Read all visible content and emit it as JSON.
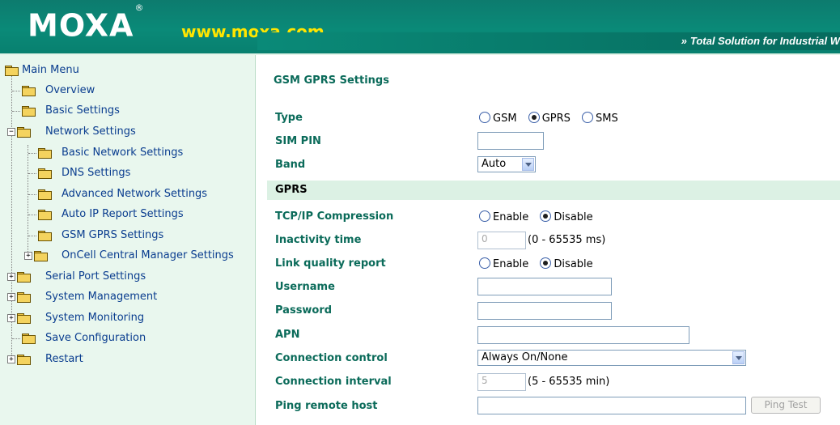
{
  "header": {
    "logo_text": "MOXA",
    "logo_mark": "®",
    "site_url": "www.moxa.com",
    "tagline_arrows": "»",
    "tagline": "Total Solution for Industrial W"
  },
  "sidebar": {
    "items": [
      {
        "label": "Main Menu",
        "expander": ""
      },
      {
        "label": "Overview",
        "expander": ""
      },
      {
        "label": "Basic Settings",
        "expander": ""
      },
      {
        "label": "Network Settings",
        "expander": "−"
      },
      {
        "label": "Basic Network Settings",
        "expander": ""
      },
      {
        "label": "DNS Settings",
        "expander": ""
      },
      {
        "label": "Advanced Network Settings",
        "expander": ""
      },
      {
        "label": "Auto IP Report Settings",
        "expander": ""
      },
      {
        "label": "GSM GPRS Settings",
        "expander": ""
      },
      {
        "label": "OnCell Central Manager Settings",
        "expander": "+"
      },
      {
        "label": "Serial Port Settings",
        "expander": "+"
      },
      {
        "label": "System Management",
        "expander": "+"
      },
      {
        "label": "System Monitoring",
        "expander": "+"
      },
      {
        "label": "Save Configuration",
        "expander": ""
      },
      {
        "label": "Restart",
        "expander": "+"
      }
    ]
  },
  "main": {
    "title": "GSM GPRS Settings",
    "type": {
      "label": "Type",
      "options": [
        "GSM",
        "GPRS",
        "SMS"
      ],
      "selected": "GPRS"
    },
    "sim_pin": {
      "label": "SIM PIN",
      "value": ""
    },
    "band": {
      "label": "Band",
      "value": "Auto"
    },
    "gprs_section": "GPRS",
    "tcp_ip_compression": {
      "label": "TCP/IP Compression",
      "options": [
        "Enable",
        "Disable"
      ],
      "selected": "Disable"
    },
    "inactivity_time": {
      "label": "Inactivity time",
      "value": "0",
      "hint": "(0 - 65535 ms)"
    },
    "link_quality_report": {
      "label": "Link quality report",
      "options": [
        "Enable",
        "Disable"
      ],
      "selected": "Disable"
    },
    "username": {
      "label": "Username",
      "value": ""
    },
    "password": {
      "label": "Password",
      "value": ""
    },
    "apn": {
      "label": "APN",
      "value": ""
    },
    "connection_control": {
      "label": "Connection control",
      "value": "Always On/None"
    },
    "connection_interval": {
      "label": "Connection interval",
      "value": "5",
      "hint": "(5 - 65535 min)"
    },
    "ping_remote_host": {
      "label": "Ping remote host",
      "value": "",
      "button": "Ping Test"
    }
  },
  "colors": {
    "header_bg": "#0a8a78",
    "url_yellow": "#ffe500",
    "sidebar_bg": "#e9f7ee",
    "label_green": "#0b6b5a",
    "section_bg": "#dcf1e4",
    "link_blue": "#0a3d8f"
  }
}
